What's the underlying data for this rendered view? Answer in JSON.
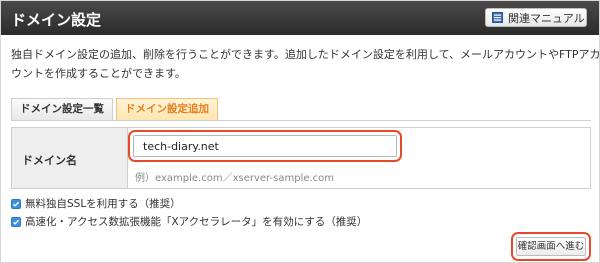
{
  "header": {
    "title": "ドメイン設定",
    "manual_button": "関連マニュアル",
    "manual_icon": "book-icon"
  },
  "description": {
    "line1": "独自ドメイン設定の追加、削除を行うことができます。追加したドメイン設定を利用して、メールアカウントやFTPアカ",
    "line2": "ウントを作成することができます。"
  },
  "tabs": [
    {
      "label": "ドメイン設定一覧",
      "active": false
    },
    {
      "label": "ドメイン設定追加",
      "active": true
    }
  ],
  "form": {
    "domain_label": "ドメイン名",
    "domain_value": "tech-diary.net",
    "example": "例）example.com／xserver-sample.com"
  },
  "options": [
    {
      "label": "無料独自SSLを利用する（推奨）",
      "checked": true
    },
    {
      "label": "高速化・アクセス数拡張機能「Xアクセラレータ」を有効にする（推奨）",
      "checked": true
    }
  ],
  "actions": {
    "confirm": "確認画面へ進む"
  },
  "colors": {
    "header_bg": "#333333",
    "active_tab_text": "#e67e22",
    "highlight": "#e8482b",
    "checkbox": "#3d8fe0"
  }
}
